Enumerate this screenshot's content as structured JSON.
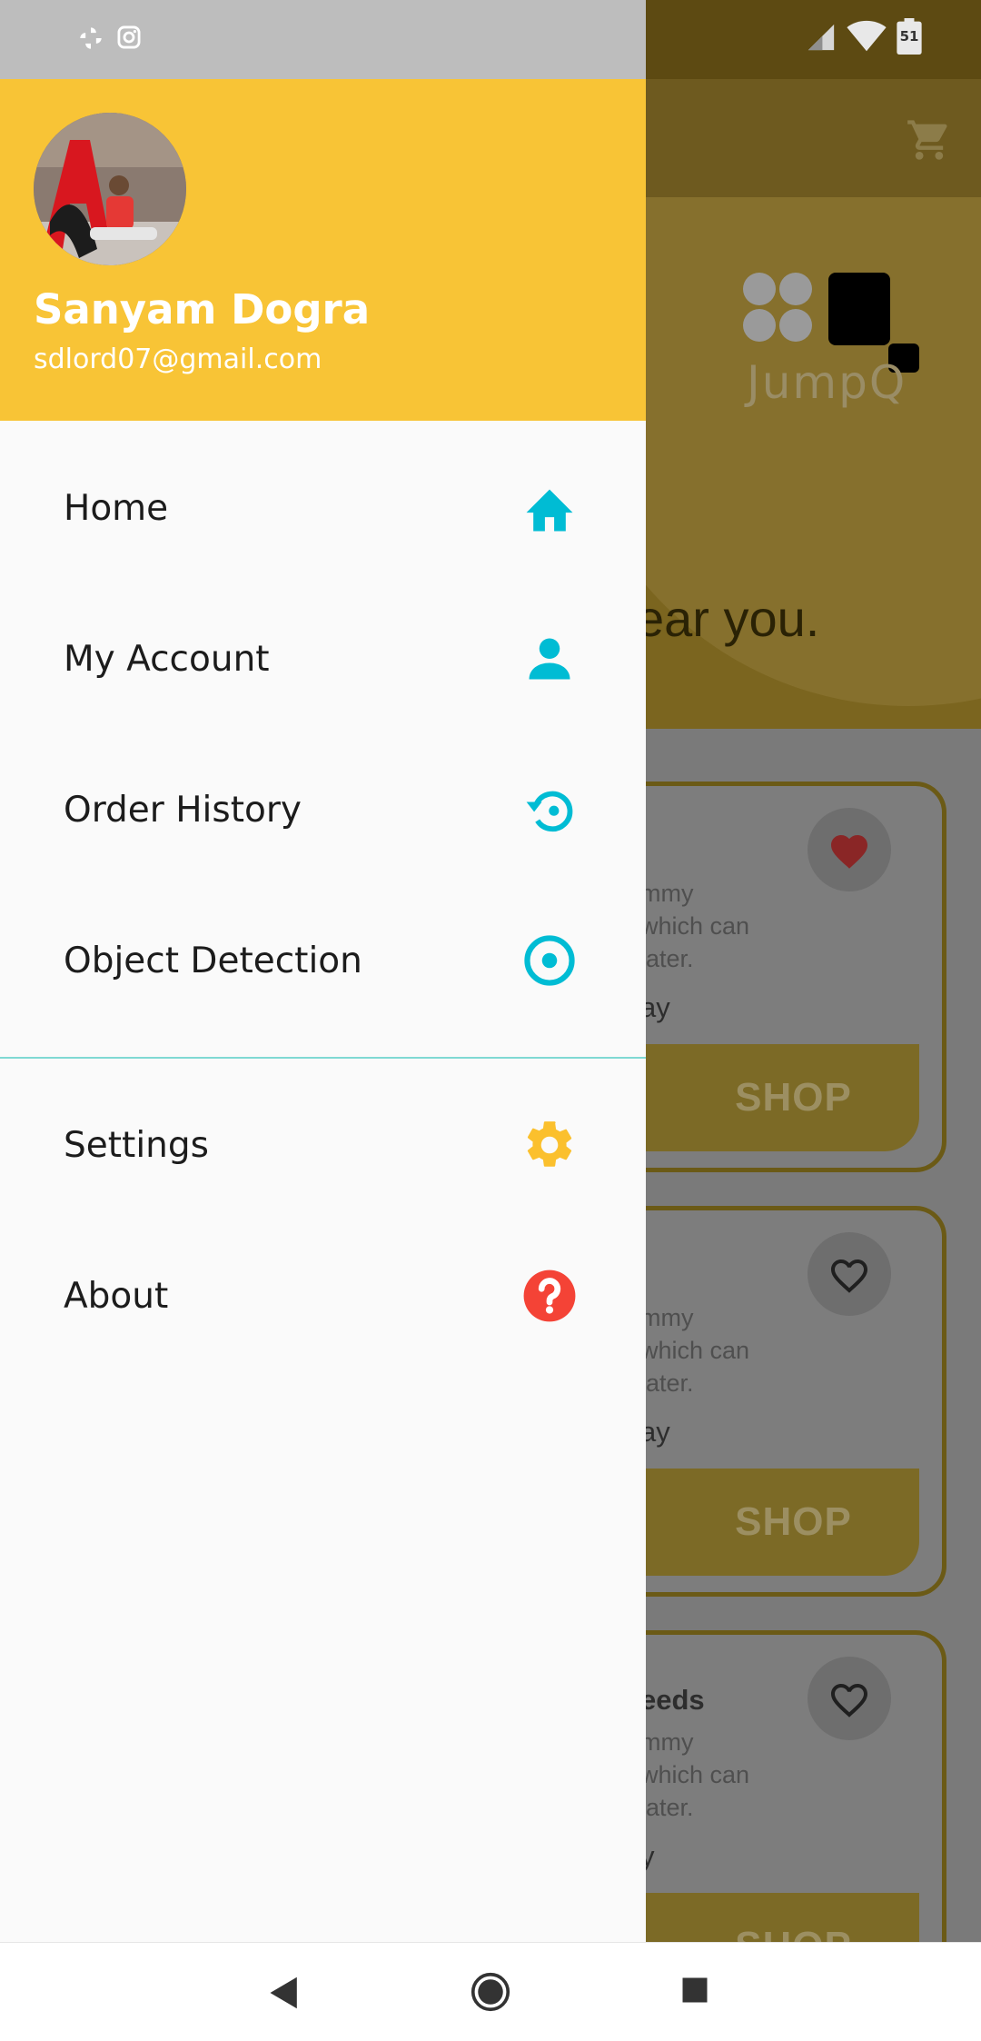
{
  "status_bar": {
    "battery_level": "51",
    "icons": [
      "pinwheel-icon",
      "instagram-icon",
      "signal-icon",
      "wifi-icon",
      "battery-icon"
    ]
  },
  "drawer": {
    "header": {
      "user_name": "Sanyam Dogra",
      "user_email": "sdlord07@gmail.com",
      "background_color": "#f8c436"
    },
    "menu_items": [
      {
        "label": "Home",
        "icon": "home-icon",
        "icon_color": "#00bcd4"
      },
      {
        "label": "My Account",
        "icon": "person-icon",
        "icon_color": "#00bcd4"
      },
      {
        "label": "Order History",
        "icon": "history-icon",
        "icon_color": "#00bcd4"
      },
      {
        "label": "Object  Detection",
        "icon": "target-icon",
        "icon_color": "#00bcd4"
      },
      {
        "label": "Settings",
        "icon": "gear-icon",
        "icon_color": "#fbc02d"
      },
      {
        "label": "About",
        "icon": "help-icon",
        "icon_color": "#f44336"
      }
    ]
  },
  "background_app": {
    "logo_text": "JumpQ",
    "tagline_fragment": "ear you.",
    "cards": [
      {
        "title": "",
        "description_lines": [
          "mmy",
          " which can",
          "later."
        ],
        "footer": "ay",
        "button": "SHOP",
        "favorited": true
      },
      {
        "title": "",
        "description_lines": [
          "mmy",
          " which can",
          "later."
        ],
        "footer": "ay",
        "button": "SHOP",
        "favorited": false
      },
      {
        "title": "eeds",
        "description_lines": [
          "mmy",
          " which can",
          "later."
        ],
        "footer": "y",
        "button": "SHOP",
        "favorited": false
      }
    ]
  },
  "nav_bar": {
    "buttons": [
      "back-button",
      "home-button",
      "recents-button"
    ]
  }
}
